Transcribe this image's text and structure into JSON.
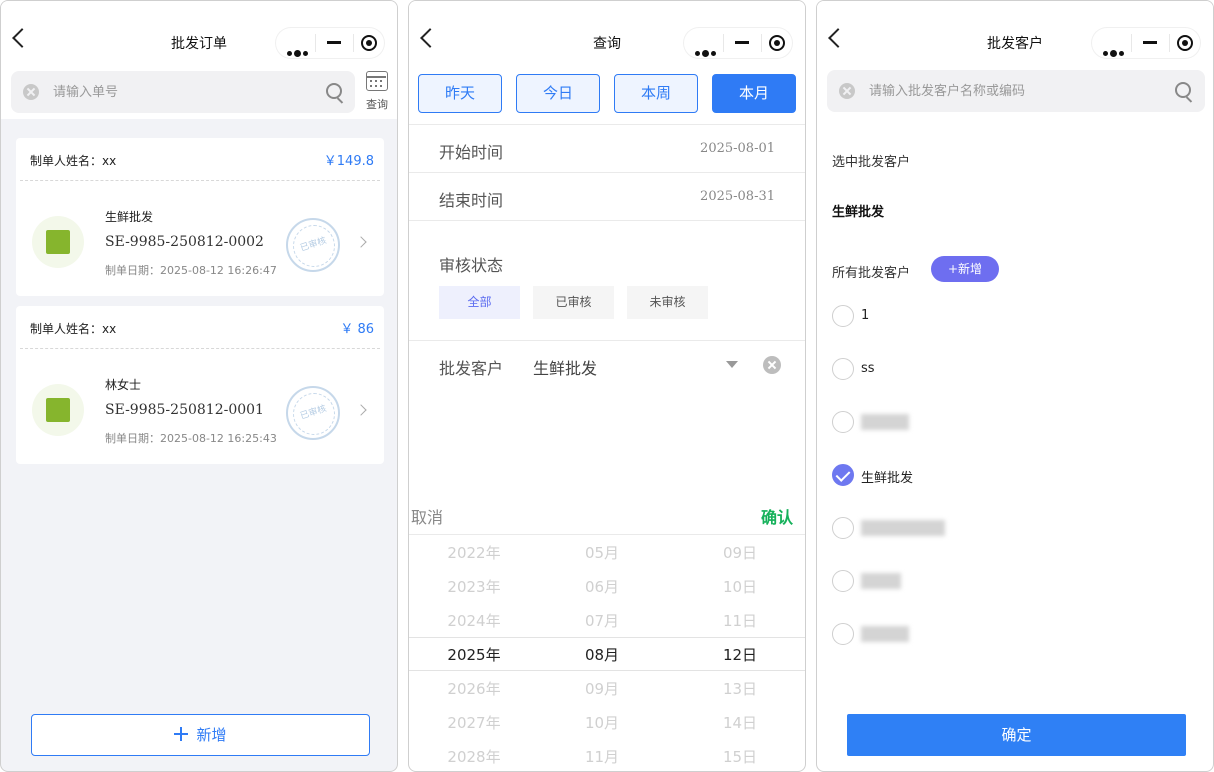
{
  "panel1": {
    "title": "批发订单",
    "search_placeholder": "请输入单号",
    "calendar_label": "查询",
    "orders": [
      {
        "creator": "制单人姓名：xx",
        "amount": "￥149.8",
        "customer": "生鲜批发",
        "order_no": "SE-9985-250812-0002",
        "date": "制单日期：2025-08-12 16:26:47",
        "stamp": "已审核"
      },
      {
        "creator": "制单人姓名：xx",
        "amount": "￥ 86",
        "customer": "林女士",
        "order_no": "SE-9985-250812-0001",
        "date": "制单日期：2025-08-12 16:25:43",
        "stamp": "已审核"
      }
    ],
    "add_label": "新增"
  },
  "panel2": {
    "title": "查询",
    "range_buttons": [
      "昨天",
      "今日",
      "本周",
      "本月"
    ],
    "start_label": "开始时间",
    "start_value": "2025-08-01",
    "end_label": "结束时间",
    "end_value": "2025-08-31",
    "status_label": "审核状态",
    "status_options": [
      "全部",
      "已审核",
      "未审核"
    ],
    "customer_label": "批发客户",
    "customer_value": "生鲜批发",
    "picker_cancel": "取消",
    "picker_confirm": "确认",
    "years": [
      "2022年",
      "2023年",
      "2024年",
      "2025年",
      "2026年",
      "2027年",
      "2028年"
    ],
    "months": [
      "05月",
      "06月",
      "07月",
      "08月",
      "09月",
      "10月",
      "11月"
    ],
    "days": [
      "09日",
      "10日",
      "11日",
      "12日",
      "13日",
      "14日",
      "15日"
    ]
  },
  "panel3": {
    "title": "批发客户",
    "search_placeholder": "请输入批发客户名称或编码",
    "selected_label": "选中批发客户",
    "selected_value": "生鲜批发",
    "all_label": "所有批发客户",
    "new_label": "+新增",
    "options": [
      "1",
      "ss",
      "生鲜批发"
    ],
    "confirm_label": "确定"
  },
  "colors": {
    "accent": "#2f7bf5",
    "green": "#16b15b",
    "purple": "#6e6ef0"
  }
}
